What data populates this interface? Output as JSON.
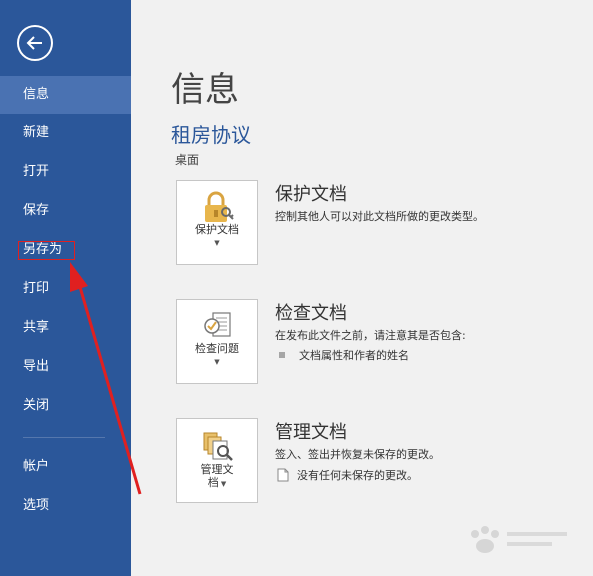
{
  "sidebar": {
    "items": [
      {
        "label": "信息"
      },
      {
        "label": "新建"
      },
      {
        "label": "打开"
      },
      {
        "label": "保存"
      },
      {
        "label": "另存为"
      },
      {
        "label": "打印"
      },
      {
        "label": "共享"
      },
      {
        "label": "导出"
      },
      {
        "label": "关闭"
      },
      {
        "label": "帐户"
      },
      {
        "label": "选项"
      }
    ],
    "active_index": 0
  },
  "main": {
    "title": "信息",
    "doc_name": "租房协议",
    "doc_location": "桌面",
    "sections": [
      {
        "tile_label": "保护文档",
        "title": "保护文档",
        "description": "控制其他人可以对此文档所做的更改类型。"
      },
      {
        "tile_label": "检查问题",
        "title": "检查文档",
        "description": "在发布此文件之前，请注意其是否包含:",
        "bullets": [
          "文档属性和作者的姓名"
        ]
      },
      {
        "tile_label_line1": "管理文",
        "tile_label_line2": "档",
        "title": "管理文档",
        "description": "签入、签出并恢复未保存的更改。",
        "bullets": [
          "没有任何未保存的更改。"
        ]
      }
    ]
  },
  "icons": {
    "back": "back-arrow-icon",
    "protect": "lock-key-icon",
    "inspect": "inspect-document-icon",
    "manage": "manage-versions-icon"
  },
  "colors": {
    "sidebar": "#2b579a",
    "sidebar_active": "#4a72b2",
    "accent": "#2b579a",
    "annotation": "#e02020"
  }
}
